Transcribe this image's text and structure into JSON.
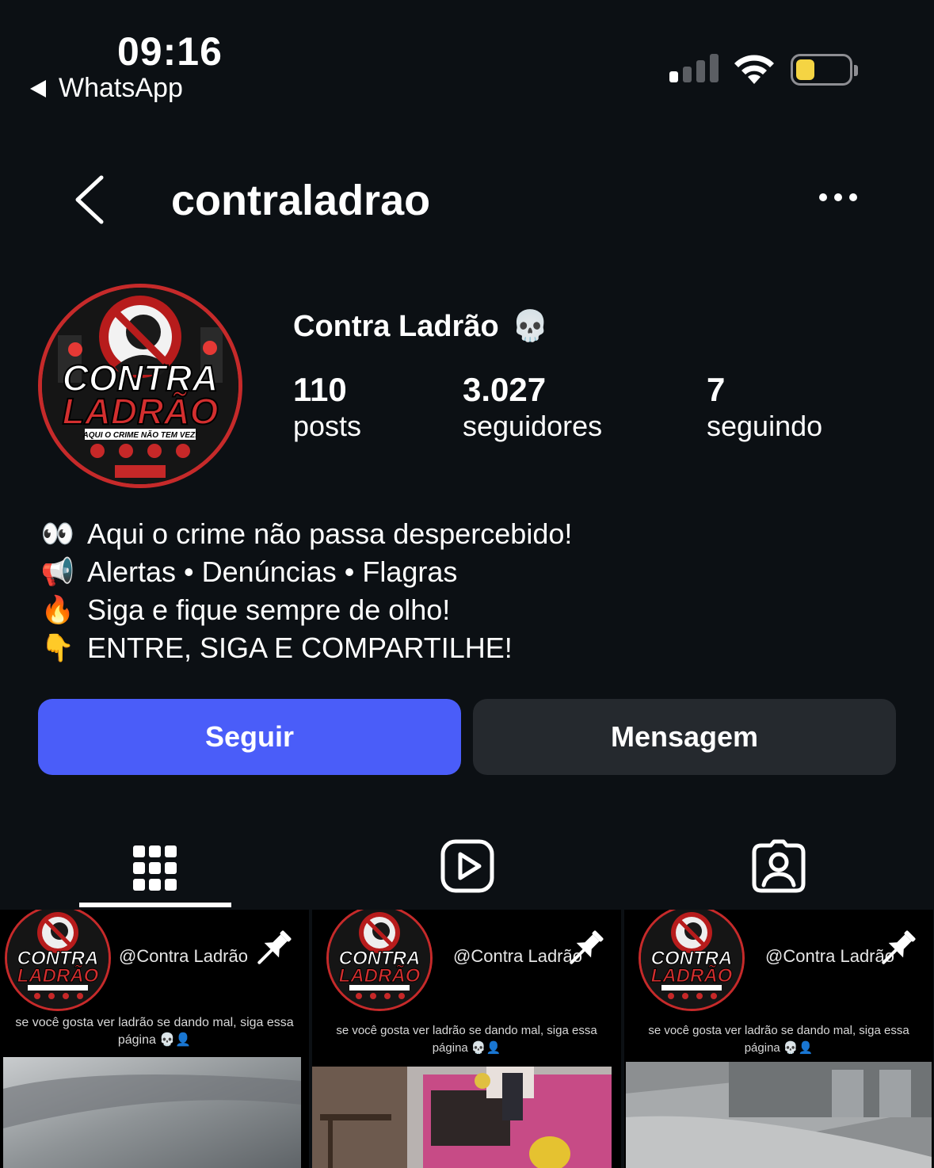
{
  "status_bar": {
    "time": "09:16",
    "back_app_label": "WhatsApp",
    "icons": [
      "cellular-signal-icon",
      "wifi-icon",
      "battery-icon"
    ],
    "battery_level": 0.35,
    "battery_color": "#f5d443"
  },
  "header": {
    "username": "contraladrao",
    "back_icon": "chevron-left-icon",
    "more_icon": "more-horizontal-icon"
  },
  "profile": {
    "display_name": "Contra Ladrão",
    "display_name_emoji": "💀",
    "avatar_text_top": "CONTRA",
    "avatar_text_bottom": "LADRÃO",
    "avatar_tagline": "AQUI O CRIME NÃO TEM VEZ!",
    "stats": [
      {
        "value": "110",
        "label": "posts"
      },
      {
        "value": "3.027",
        "label": "seguidores"
      },
      {
        "value": "7",
        "label": "seguindo"
      }
    ],
    "bio": [
      {
        "emoji": "👀",
        "text": "Aqui o crime não passa despercebido!"
      },
      {
        "emoji": "📢",
        "text": "Alertas • Denúncias • Flagras"
      },
      {
        "emoji": "🔥",
        "text": "Siga e fique sempre de olho!"
      },
      {
        "emoji": "👇",
        "text": "ENTRE, SIGA E COMPARTILHE!"
      }
    ]
  },
  "actions": {
    "follow_label": "Seguir",
    "message_label": "Mensagem",
    "follow_color": "#4a5df9"
  },
  "tabs": [
    {
      "icon": "grid-icon",
      "active": true
    },
    {
      "icon": "reels-icon",
      "active": false
    },
    {
      "icon": "tagged-icon",
      "active": false
    }
  ],
  "posts": [
    {
      "handle": "@Contra Ladrão",
      "caption_line1": "se você gosta ver ladrão se dando mal, siga essa",
      "caption_line2": "página 💀👤",
      "pinned": true
    },
    {
      "handle": "@Contra Ladrão",
      "caption_line1": "se você gosta ver ladrão se dando mal, siga essa",
      "caption_line2": "página 💀👤",
      "pinned": true
    },
    {
      "handle": "@Contra Ladrão",
      "caption_line1": "se você gosta ver ladrão se dando mal, siga essa",
      "caption_line2": "página 💀👤",
      "pinned": true
    }
  ]
}
